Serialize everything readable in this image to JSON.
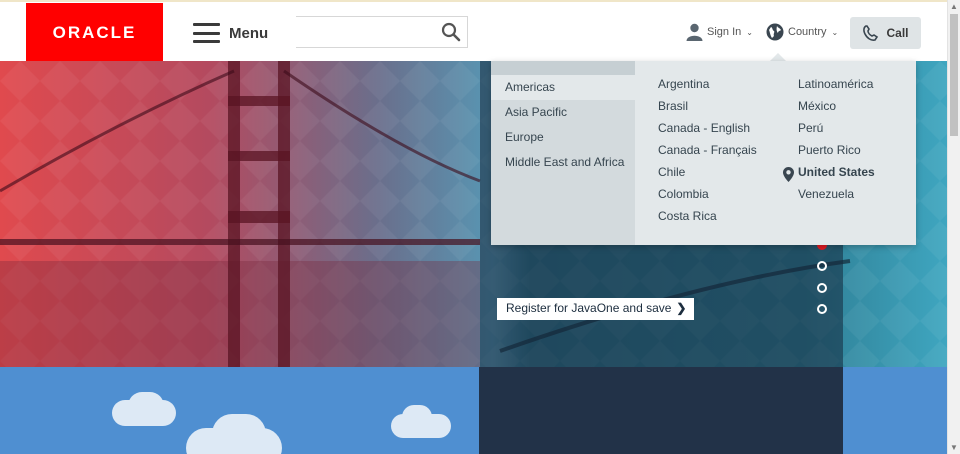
{
  "header": {
    "logo_text": "ORACLE",
    "menu_label": "Menu",
    "search_placeholder": "",
    "signin_label": "Sign In",
    "country_label": "Country",
    "call_label": "Call"
  },
  "hero": {
    "register_label": "Register for JavaOne and save",
    "register_arrow": "❯",
    "carousel_dots": 4,
    "active_dot": 1
  },
  "country_menu": {
    "regions": [
      "Americas",
      "Asia Pacific",
      "Europe",
      "Middle East and Africa"
    ],
    "active_region": "Americas",
    "countries_col1": [
      "Argentina",
      "Brasil",
      "Canada - English",
      "Canada - Français",
      "Chile",
      "Colombia",
      "Costa Rica"
    ],
    "countries_col2": [
      "Latinoamérica",
      "México",
      "Perú",
      "Puerto Rico",
      "United States",
      "Venezuela"
    ],
    "current_country": "United States"
  },
  "colors": {
    "brand_red": "#ff0000",
    "dropdown_bg": "#e3e8ea",
    "active_dot": "#e31b23"
  }
}
